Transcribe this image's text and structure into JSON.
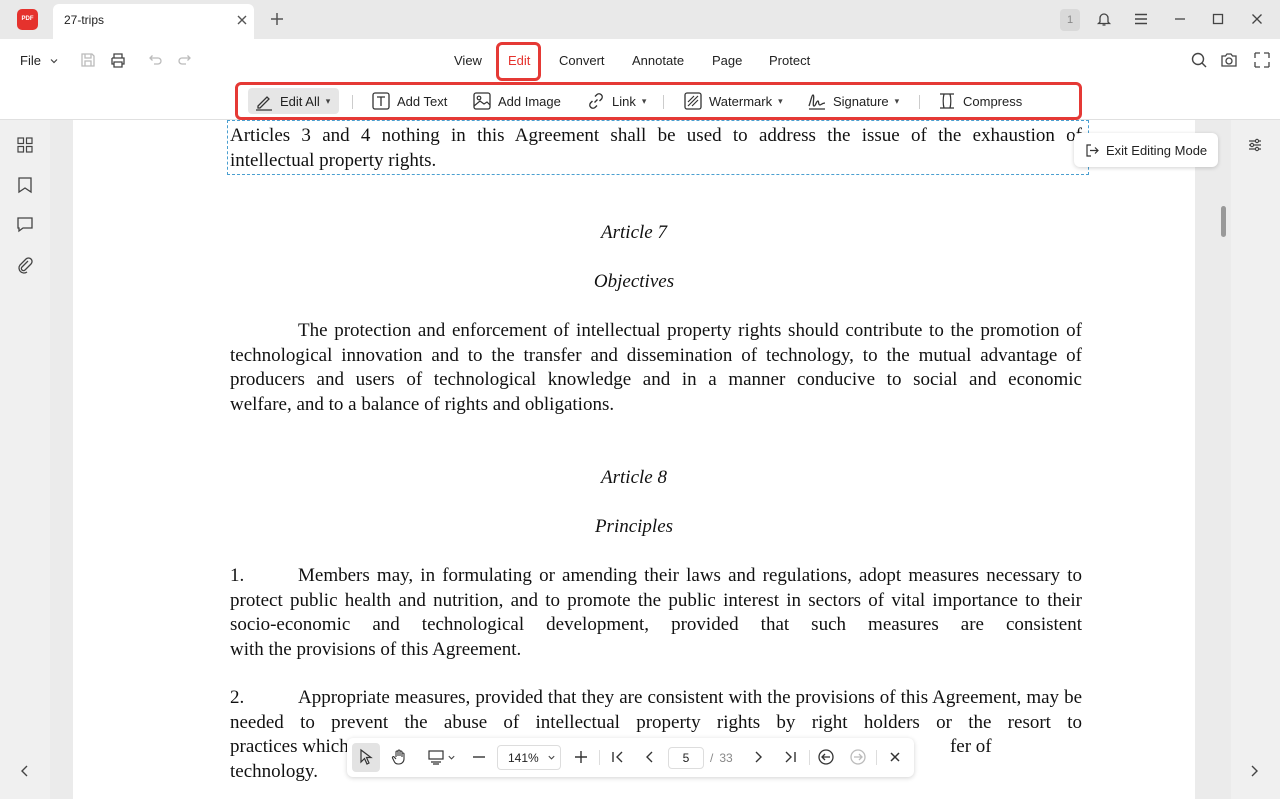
{
  "titlebar": {
    "logo_text": "PDF",
    "tab_title": "27-trips",
    "window_count": "1"
  },
  "menubar": {
    "file_label": "File",
    "tabs": [
      {
        "label": "View"
      },
      {
        "label": "Edit"
      },
      {
        "label": "Convert"
      },
      {
        "label": "Annotate"
      },
      {
        "label": "Page"
      },
      {
        "label": "Protect"
      }
    ],
    "active_tab": "Edit"
  },
  "edit_toolbar": {
    "edit_all": "Edit All",
    "add_text": "Add Text",
    "add_image": "Add Image",
    "link": "Link",
    "watermark": "Watermark",
    "signature": "Signature",
    "compress": "Compress"
  },
  "exit_editing": "Exit Editing Mode",
  "document": {
    "para_top": "Articles 3 and 4 nothing in this Agreement shall be used to address the issue of the exhaustion of",
    "para_top_last": "intellectual property rights.",
    "article7_title": "Article 7",
    "article7_subtitle": "Objectives",
    "article7_lines": [
      "The protection and enforcement of intellectual property rights should contribute to the promotion",
      "of technological innovation and to the transfer and dissemination of technology, to the mutual advantage",
      "of producers and users of technological knowledge and in a manner conducive to social and economic"
    ],
    "article7_last": "welfare, and to a balance of rights and obligations.",
    "article8_title": "Article 8",
    "article8_subtitle": "Principles",
    "item1_num": "1.",
    "item1_first": "Members may, in formulating or amending their laws and regulations, adopt measures necessary",
    "item1_lines": [
      "to protect public health and nutrition, and to promote the public interest in sectors of vital importance",
      "to their socio-economic and technological development, provided that such measures are consistent"
    ],
    "item1_last": "with the provisions of this Agreement.",
    "item2_num": "2.",
    "item2_first": "Appropriate measures, provided that they are consistent with the provisions of this Agreement,",
    "item2_lines": [
      "may be needed to prevent the abuse of intellectual property rights by right holders or the resort to"
    ],
    "item2_last_start": "practices which u",
    "item2_last_end": "fer of technology."
  },
  "bottom_nav": {
    "zoom": "141%",
    "current_page": "5",
    "page_separator": "/",
    "total_pages": "33"
  },
  "colors": {
    "accent": "#e5322d",
    "highlight": "#e53935",
    "edit_box_border": "#4a9fd0"
  }
}
